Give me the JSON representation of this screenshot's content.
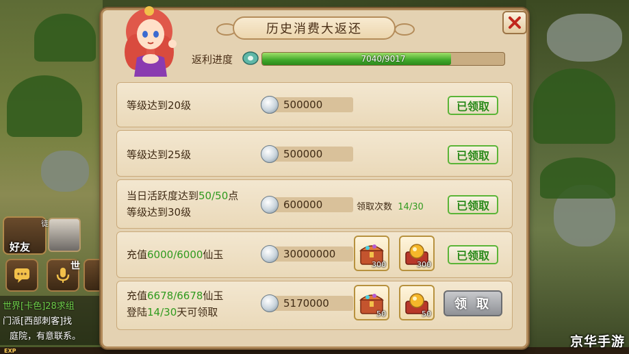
{
  "panel": {
    "title": "历史消费大返还",
    "progress": {
      "label": "返利进度",
      "text": "7040/9017",
      "fraction": 0.7807
    },
    "rows": [
      {
        "lines": [
          "等级达到20级"
        ],
        "amount": "500000",
        "button": "已领取",
        "button_state": "claimed"
      },
      {
        "lines": [
          "等级达到25级"
        ],
        "amount": "500000",
        "button": "已领取",
        "button_state": "claimed"
      },
      {
        "line1_prefix": "当日活跃度达到",
        "line1_value": "50/50",
        "line1_suffix": "点",
        "line2": "等级达到30级",
        "amount": "600000",
        "count_label": "领取次数",
        "count_value": "14/30",
        "button": "已领取",
        "button_state": "claimed"
      },
      {
        "line1_prefix": "充值",
        "line1_value": "6000/6000",
        "line1_suffix": "仙玉",
        "amount": "30000000",
        "items": [
          {
            "icon": "treasure-chest-icon",
            "qty": "300"
          },
          {
            "icon": "gold-orb-box-icon",
            "qty": "300"
          }
        ],
        "button": "已领取",
        "button_state": "claimed"
      },
      {
        "line1_prefix": "充值",
        "line1_value": "6678/6678",
        "line1_suffix": "仙玉",
        "line2_prefix": "登陆",
        "line2_value": "14/30",
        "line2_suffix": "天可领取",
        "amount": "5170000",
        "items": [
          {
            "icon": "treasure-chest-icon",
            "qty": "50"
          },
          {
            "icon": "gold-orb-box-icon",
            "qty": "50"
          }
        ],
        "button": "领 取",
        "button_state": "available"
      }
    ]
  },
  "hud": {
    "friend_label": "好友",
    "apprentice_tag": "徒",
    "world_label": "世",
    "chat": [
      {
        "prefix": "世界",
        "tag": "[卡色]",
        "text": "28求组"
      },
      {
        "prefix": "门派",
        "tag": "[西部刺客]",
        "text": "找"
      },
      {
        "prefix": "",
        "tag": "",
        "text": "庭院，有意联系。"
      }
    ],
    "exp_label": "EXP"
  },
  "watermark": "京华手游",
  "colors": {
    "highlight_green": "#2f9a1e",
    "claimed_border": "#5ab436",
    "panel_bg": "#e4d2b2"
  }
}
